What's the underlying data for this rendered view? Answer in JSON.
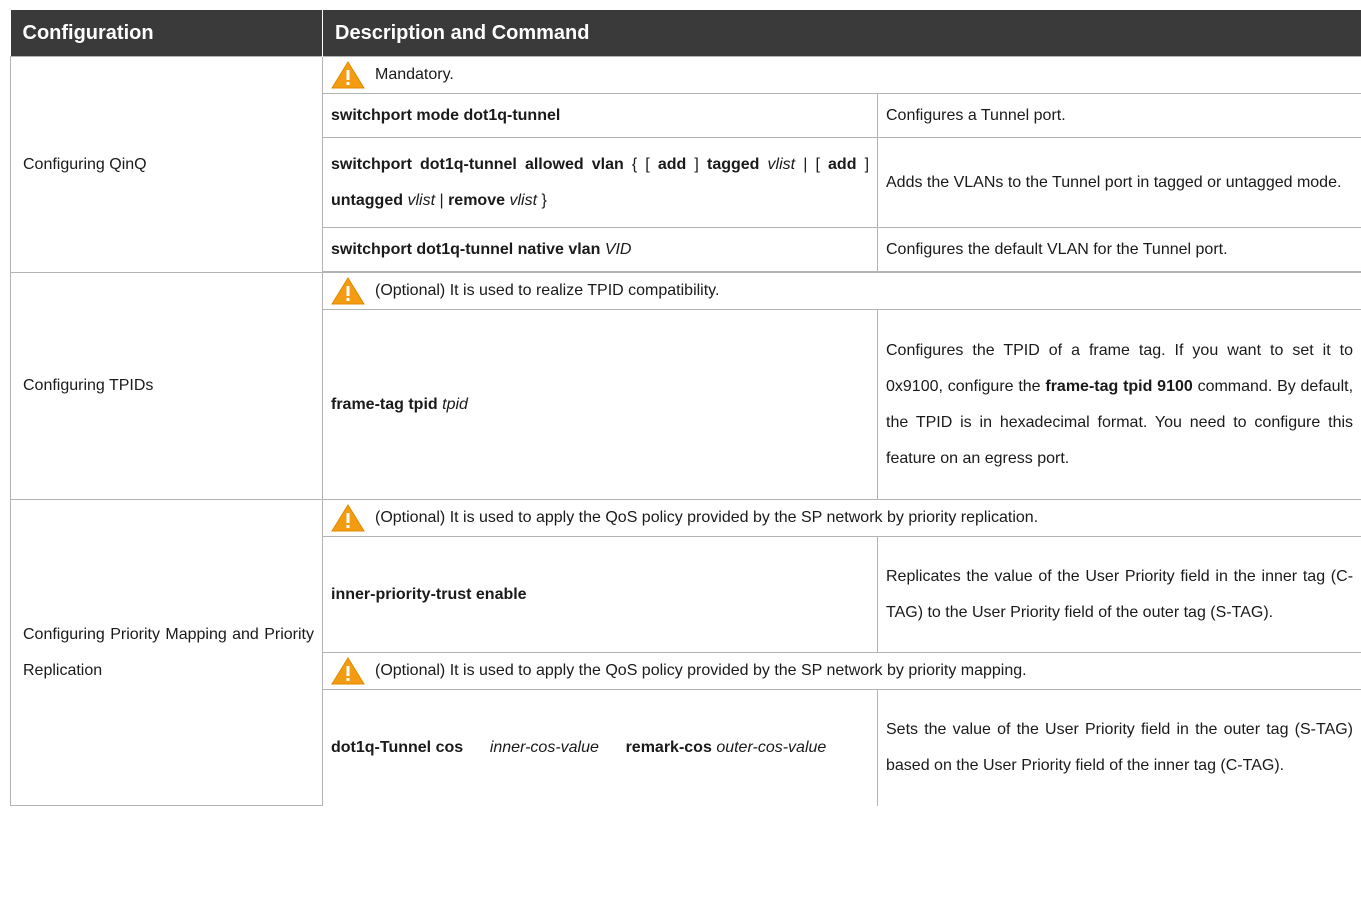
{
  "header": {
    "col1": "Configuration",
    "col2": "Description and Command"
  },
  "colors": {
    "header_bg": "#3a3a3a",
    "warning_icon": "#f39c12",
    "border": "#b3b3b3"
  },
  "sections": [
    {
      "name": "Configuring QinQ",
      "note": "Mandatory.",
      "rows": [
        {
          "description": "Configures a Tunnel port."
        },
        {
          "description": "Adds the VLANs to the Tunnel port in tagged or untagged mode."
        },
        {
          "description": "Configures the default VLAN for the Tunnel port."
        }
      ]
    },
    {
      "name": "Configuring TPIDs",
      "note": "(Optional) It is used to realize TPID compatibility.",
      "rows": [
        {
          "description": "Configures the TPID of a frame tag. If you want to set it to 0x9100, configure the frame-tag tpid 9100 command. By default, the TPID is in hexadecimal format. You need to configure this feature on an egress port."
        }
      ]
    },
    {
      "name": "Configuring Priority Mapping and Priority Replication",
      "notes": [
        "(Optional) It is used to apply the QoS policy provided by the SP network by priority replication.",
        "(Optional) It is used to apply the QoS policy provided by the SP network by priority mapping."
      ],
      "rows": [
        {
          "description": "Replicates the value of the User Priority field in the inner tag (C-TAG) to the User Priority field of the outer tag (S-TAG)."
        },
        {
          "description": "Sets the value of the User Priority field in the outer tag (S-TAG) based on the User Priority field of the inner tag (C-TAG)."
        }
      ]
    }
  ],
  "commands": {
    "qinq_mode": {
      "kw": "switchport mode dot1q-tunnel"
    },
    "qinq_allowed": {
      "kw1": "switchport dot1q-tunnel allowed vlan",
      "brace_open": "{ [",
      "add1": "add",
      "bracket_close1": "]",
      "tagged": "tagged",
      "vlist1": "vlist",
      "sep1": "| [",
      "add2": "add",
      "bracket_close2": "]",
      "untagged": "untagged",
      "vlist2": "vlist",
      "sep2": "|",
      "remove": "remove",
      "vlist3": "vlist",
      "brace_close": "}"
    },
    "qinq_native": {
      "kw": "switchport dot1q-tunnel native vlan",
      "arg": "VID"
    },
    "tpid": {
      "kw": "frame-tag tpid",
      "arg": "tpid"
    },
    "inner_trust": {
      "kw": "inner-priority-trust enable"
    },
    "cos": {
      "kw1": "dot1q-Tunnel cos",
      "arg1": "inner-cos-value",
      "kw2": "remark-cos",
      "arg2": "outer-cos-value"
    }
  },
  "inline": {
    "tpid_desc_pre": "Configures the TPID of a frame tag. If you want to set it to 0x9100, configure the",
    "tpid_desc_bold": "frame-tag tpid 9100",
    "tpid_desc_post": "command. By default, the TPID is in hexadecimal format. You need to configure this feature on an egress port."
  }
}
